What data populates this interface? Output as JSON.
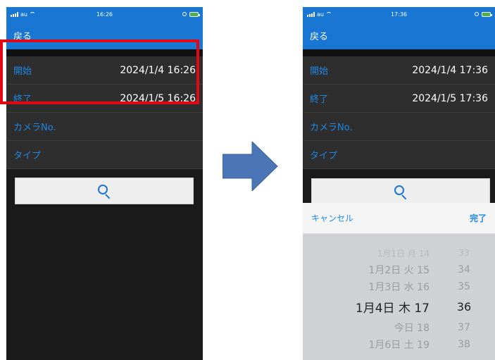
{
  "left_screen": {
    "status": {
      "carrier": "au",
      "time": "16:26"
    },
    "nav": {
      "back_label": "戻る"
    },
    "rows": {
      "start": {
        "label": "開始",
        "value": "2024/1/4 16:26"
      },
      "end": {
        "label": "終了",
        "value": "2024/1/5 16:26"
      },
      "camera": {
        "label": "カメラNo."
      },
      "type": {
        "label": "タイプ"
      }
    },
    "highlight_color": "#e30613"
  },
  "right_screen": {
    "status": {
      "carrier": "au",
      "time": "17:36"
    },
    "nav": {
      "back_label": "戻る"
    },
    "rows": {
      "start": {
        "label": "開始",
        "value": "2024/1/4 17:36"
      },
      "end": {
        "label": "終了",
        "value": "2024/1/5 17:36"
      },
      "camera": {
        "label": "カメラNo."
      },
      "type": {
        "label": "タイプ"
      }
    },
    "picker": {
      "cancel_label": "キャンセル",
      "done_label": "完了",
      "rows": [
        {
          "date": "1月1日 月 14",
          "minute": "33"
        },
        {
          "date": "1月2日 火 15",
          "minute": "34"
        },
        {
          "date": "1月3日 水 16",
          "minute": "35"
        },
        {
          "date": "1月4日 木 17",
          "minute": "36"
        },
        {
          "date": "今日 18",
          "minute": "37"
        },
        {
          "date": "1月6日 土 19",
          "minute": "38"
        }
      ],
      "selected_index": 3
    }
  },
  "colors": {
    "accent_blue": "#1976d2",
    "label_blue": "#1e88e5",
    "arrow_fill": "#4a76b8",
    "battery_green": "#4caf50"
  },
  "icons": [
    "search-icon",
    "signal-icon",
    "wifi-icon",
    "alarm-icon",
    "battery-icon",
    "arrow-right-icon"
  ]
}
